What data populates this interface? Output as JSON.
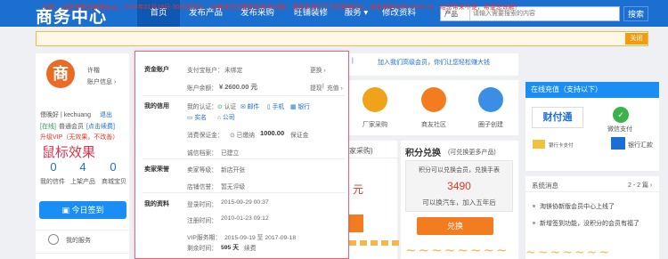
{
  "header": {
    "logo": "商务中心",
    "nav": [
      "首页",
      "发布产品",
      "发布采购",
      "旺铺装修",
      "服务 ▾",
      "修改资料"
    ],
    "search": {
      "select": "产品",
      "placeholder": "请输入需要搜索的内容",
      "button": "搜索"
    }
  },
  "notice": {
    "text": "你好，这是淘镁协新版后台，2016年01月19日-30日调试中，如果有任何使用和发布问题，请联系我们下方的客服QQ，或者致电4000-0532-52，给您带来不便，希望您谅解！",
    "close": "关闭"
  },
  "user": {
    "name_label": "许楷",
    "info_label": "账户信息 ›",
    "greeting": "偎晚好 | kechuang",
    "logout": "退出",
    "online": "[在线]",
    "level": "普通会员",
    "level_link": "[点击续费]",
    "vip": "升级VIP（无效果，不改善）",
    "stats": [
      {
        "value": "0",
        "label": "我的信件"
      },
      {
        "value": "4",
        "label": "上架产品"
      },
      {
        "value": "0",
        "label": "商城宝贝"
      }
    ],
    "signin": "今日签到",
    "my_service": "我的服务",
    "hover_note": "鼠标效果"
  },
  "popup": {
    "fund": {
      "title": "资金账户",
      "alipay": "支付宝账户：",
      "alipay_status": "未绑定",
      "change": "更换 ›",
      "balance_label": "账户余额：",
      "balance": "¥ 2600.00 元",
      "withdraw": "提现",
      "recharge": "充值 ›"
    },
    "credit": {
      "title": "我的信用",
      "auth_label": "我的认证：",
      "items": [
        "认证",
        "邮件",
        "手机",
        "银行",
        "实名",
        "公司"
      ],
      "deposit_label": "消费保证金：",
      "deposit_status": "已缴纳",
      "deposit_amount": "1000.00",
      "deposit_link": "保证金",
      "file_label": "诚信档案：",
      "file_status": "已建立"
    },
    "seller": {
      "title": "卖家荣誉",
      "grade_label": "卖家等级：",
      "grade": "新店开张",
      "shop_label": "店铺信誉：",
      "shop": "暂无评级"
    },
    "profile": {
      "title": "我的资料",
      "login_label": "登录时间：",
      "login": "2015-09-29 00:37",
      "reg_label": "注册时间：",
      "reg": "2010-01-23 09:12",
      "vip_label": "VIP服务期：",
      "vip": "2015-09-19 至 2017-09-18",
      "remain_label": "剩余时间：",
      "remain": "595 天",
      "renew": "续费"
    }
  },
  "middle": {
    "ad_text": "加入我们高级会员，你们让您轻松赚大钱",
    "quick": [
      {
        "label": "厂家采购",
        "color": "#f0a21a"
      },
      {
        "label": "商友社区",
        "color": "#f47c20"
      },
      {
        "label": "圈子创建",
        "color": "#3a8ee6"
      }
    ],
    "wanted_tab": "家采购)",
    "wanted_price_unit": "元",
    "points": {
      "title": "积分兑换",
      "subtitle": "(可兑换更多产品)",
      "desc": "积分可以兑换会员，兑换手表",
      "value": "3490",
      "sub": "可以换汽车，加入五年后",
      "button": "兑换"
    }
  },
  "right": {
    "recharge_title": "在线充值（支持以下）",
    "payments": [
      {
        "label": "财付通"
      },
      {
        "label": "微信支付"
      },
      {
        "label": "银行汇款"
      }
    ],
    "news_title": "系统消息",
    "news_page": "2 - 2 篇 ›",
    "news": [
      "淘镁协新版会员中心上线了",
      "新增签到功能，没积分的会员有福了"
    ]
  },
  "colors": {
    "brand": "#1a6fd1",
    "accent": "#e85f80",
    "orange": "#f47c20"
  }
}
